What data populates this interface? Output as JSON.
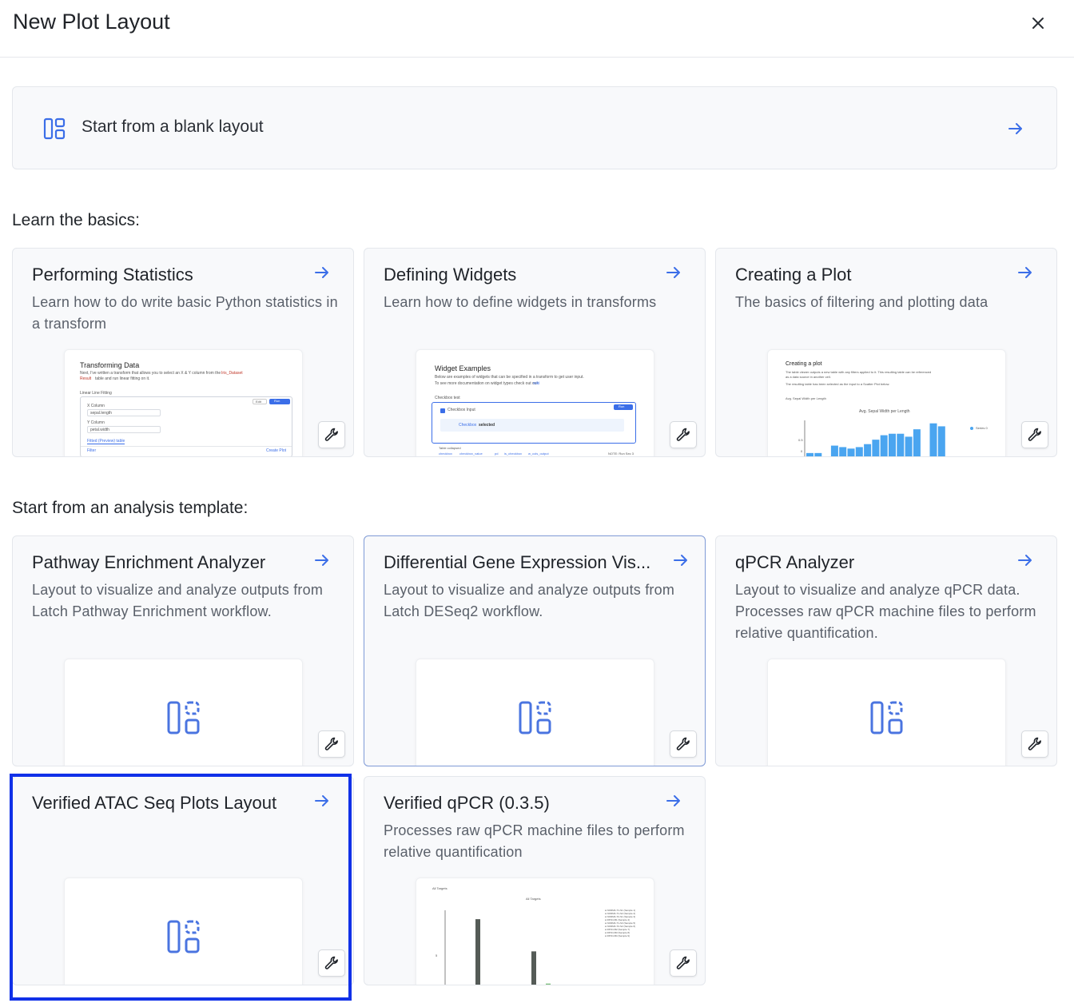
{
  "dialog": {
    "title": "New Plot Layout"
  },
  "blank_layout": {
    "label": "Start from a blank layout"
  },
  "sections": {
    "basics": "Learn the basics:",
    "templates": "Start from an analysis template:"
  },
  "basics_cards": [
    {
      "title": "Performing Statistics",
      "description": "Learn how to do write basic Python statistics in a transform"
    },
    {
      "title": "Defining Widgets",
      "description": "Learn how to define widgets in transforms"
    },
    {
      "title": "Creating a Plot",
      "description": "The basics of filtering and plotting data"
    }
  ],
  "template_cards": [
    {
      "title": "Pathway Enrichment Analyzer",
      "description": "Layout to visualize and analyze outputs from Latch Pathway Enrichment workflow."
    },
    {
      "title": "Differential Gene Expression Vis...",
      "description": "Layout to visualize and analyze outputs from Latch DESeq2 workflow."
    },
    {
      "title": "qPCR Analyzer",
      "description": "Layout to visualize and analyze qPCR data. Processes raw qPCR machine files to perform relative quantification."
    },
    {
      "title": "Verified ATAC Seq Plots Layout",
      "description": ""
    },
    {
      "title": "Verified qPCR (0.3.5)",
      "description": "Processes raw qPCR machine files to perform relative quantification"
    }
  ],
  "previews": {
    "stats": {
      "title": "Transforming Data",
      "line1": "Next, I've written a transform that allows you to select an X & Y column from the",
      "code": "Iris_Dataset",
      "line2": "Result",
      "line2b": "table and run linear fitting on it.",
      "fn": "Linear Line Fitting",
      "xlabel": "X Column",
      "xvalue": "sepal.length",
      "ylabel": "Y Column",
      "yvalue": "petal.width",
      "tab": "Fitted (Preview) table",
      "filter": "Filter",
      "create": "Create Plot",
      "edit": "Edit",
      "run": "Run"
    },
    "widgets": {
      "title": "Widget Examples",
      "line1": "Below are examples of widgets that can be specified in a transform to get user input.",
      "line2": "To see more documentation on widget types check out our",
      "wiki": "wiki",
      "cell": "Checkbox test",
      "input": "Checkbox Input",
      "selected_a": "Checkbox",
      "selected_b": "selected",
      "tags": [
        "checkbox",
        "checkbox_value",
        "pd",
        "is_checkbox",
        "w_cols_output"
      ],
      "meta": "Table collapsed",
      "note": "NOTE: Run Sec 3",
      "run": "Run"
    },
    "plot": {
      "title": "Creating a plot",
      "line1": "The table viewer outputs a new table with any filters applied to it. This resulting table can be referenced",
      "line1b": "as a data source in another cell.",
      "line2": "The resulting table has been selected as the input to a Scatter Plot below.",
      "series_label": "Avg. Sepal Width per Length",
      "chart_title": "Avg. Sepal Width per Length",
      "legend": "Series 0",
      "ytick_a": "0.5",
      "ytick_b": "0"
    },
    "qpcr": {
      "tag": "All Targets",
      "chart_title": "All Targets",
      "ytick": "5",
      "legend": [
        "NORM4-T1-S1 (Sample 1)",
        "NORM4-T1-S2 (Sample 2)",
        "NORM4-T2-S1 (Sample 3)",
        "RPO4-B1 (Sample 4)",
        "NORM4-T1-S3 (Sample 5)",
        "NORM4-T2-S2 (Sample 6)",
        "RPO4-B2 (Sample 7)",
        "RPO4-B3 (Sample 8)",
        "RPO4-B4 (Sample 9)"
      ]
    }
  },
  "chart_data": [
    {
      "type": "bar",
      "title": "Avg. Sepal Width per Length",
      "legend": [
        "Series 0"
      ],
      "values": [
        0.3,
        0.3,
        0,
        0.55,
        0.5,
        0.45,
        0.5,
        0.6,
        0.75,
        0.9,
        0.95,
        0.95,
        0.85,
        1.1,
        0,
        1.3,
        1.2
      ],
      "color": "#4aa5f0"
    },
    {
      "type": "bar",
      "title": "All Targets",
      "values": [
        0.05,
        3.2,
        0.25,
        0.15,
        1.75,
        0.3,
        0.05,
        0.15,
        0.1
      ],
      "color": "#555b57"
    }
  ],
  "colors": {
    "accent": "#3b6ee8",
    "highlight": "#1131e8"
  }
}
